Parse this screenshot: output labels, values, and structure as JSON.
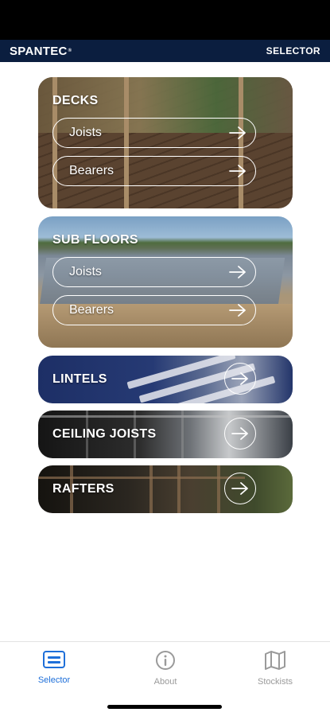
{
  "header": {
    "brand": "SPANTEC",
    "brand_mark": "®",
    "title": "SELECTOR"
  },
  "cards": {
    "decks": {
      "title": "DECKS",
      "options": [
        "Joists",
        "Bearers"
      ]
    },
    "subfloors": {
      "title": "SUB FLOORS",
      "options": [
        "Joists",
        "Bearers"
      ]
    },
    "lintels": {
      "title": "LINTELS"
    },
    "ceiling_joists": {
      "title": "CEILING JOISTS"
    },
    "rafters": {
      "title": "RAFTERS"
    }
  },
  "nav": {
    "items": [
      {
        "label": "Selector",
        "icon": "card-icon",
        "active": true
      },
      {
        "label": "About",
        "icon": "info-icon",
        "active": false
      },
      {
        "label": "Stockists",
        "icon": "map-icon",
        "active": false
      }
    ],
    "active_color": "#1e6fd9",
    "inactive_color": "#9a9a9a"
  },
  "colors": {
    "header_bg": "#0b1e3f"
  }
}
